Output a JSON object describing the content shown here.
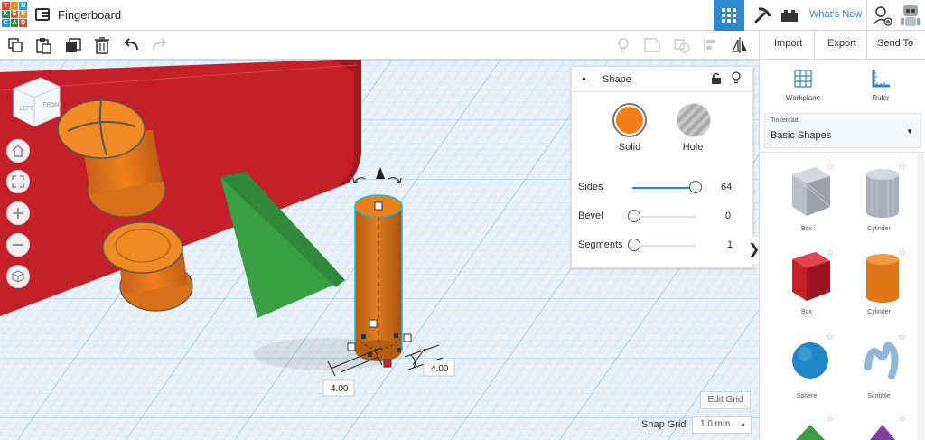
{
  "app": {
    "title": "Fingerboard",
    "logo_letters": [
      "T",
      "I",
      "N",
      "K",
      "E",
      "R",
      "C",
      "A",
      "D"
    ],
    "logo_colors": [
      "#e8473b",
      "#f38b1f",
      "#1fa0d8",
      "#2a8c4a",
      "#e8473b",
      "#f38b1f",
      "#1fa0d8",
      "#2a8c4a",
      "#e8473b"
    ]
  },
  "header": {
    "whats_new": "What's New",
    "accent": "#2b87d1"
  },
  "toolbar": {
    "import_label": "Import",
    "export_label": "Export",
    "send_to_label": "Send To"
  },
  "shape_panel": {
    "title": "Shape",
    "solid_label": "Solid",
    "hole_label": "Hole",
    "solid_color": "#f07f1a",
    "sliders": [
      {
        "label": "Sides",
        "value": "64",
        "fraction": 1.0
      },
      {
        "label": "Bevel",
        "value": "0",
        "fraction": 0.0
      },
      {
        "label": "Segments",
        "value": "1",
        "fraction": 0.0
      }
    ]
  },
  "right_panel": {
    "workplane_label": "Workplane",
    "ruler_label": "Ruler",
    "library_source": "Tinkercad",
    "library_name": "Basic Shapes",
    "items": [
      {
        "label": "Box",
        "icon": "box-gray-icon"
      },
      {
        "label": "Cylinder",
        "icon": "cylinder-gray-icon"
      },
      {
        "label": "Box",
        "icon": "box-red-icon"
      },
      {
        "label": "Cylinder",
        "icon": "cylinder-orange-icon"
      },
      {
        "label": "Sphere",
        "icon": "sphere-blue-icon"
      },
      {
        "label": "Scribble",
        "icon": "scribble-icon"
      }
    ]
  },
  "view_cube": {
    "left": "LEFT",
    "front": "FRONT"
  },
  "dimensions": {
    "width": "4.00",
    "depth": "4.00"
  },
  "bottom": {
    "edit_grid": "Edit Grid",
    "snap_grid_label": "Snap Grid",
    "snap_grid_value": "1.0 mm"
  }
}
